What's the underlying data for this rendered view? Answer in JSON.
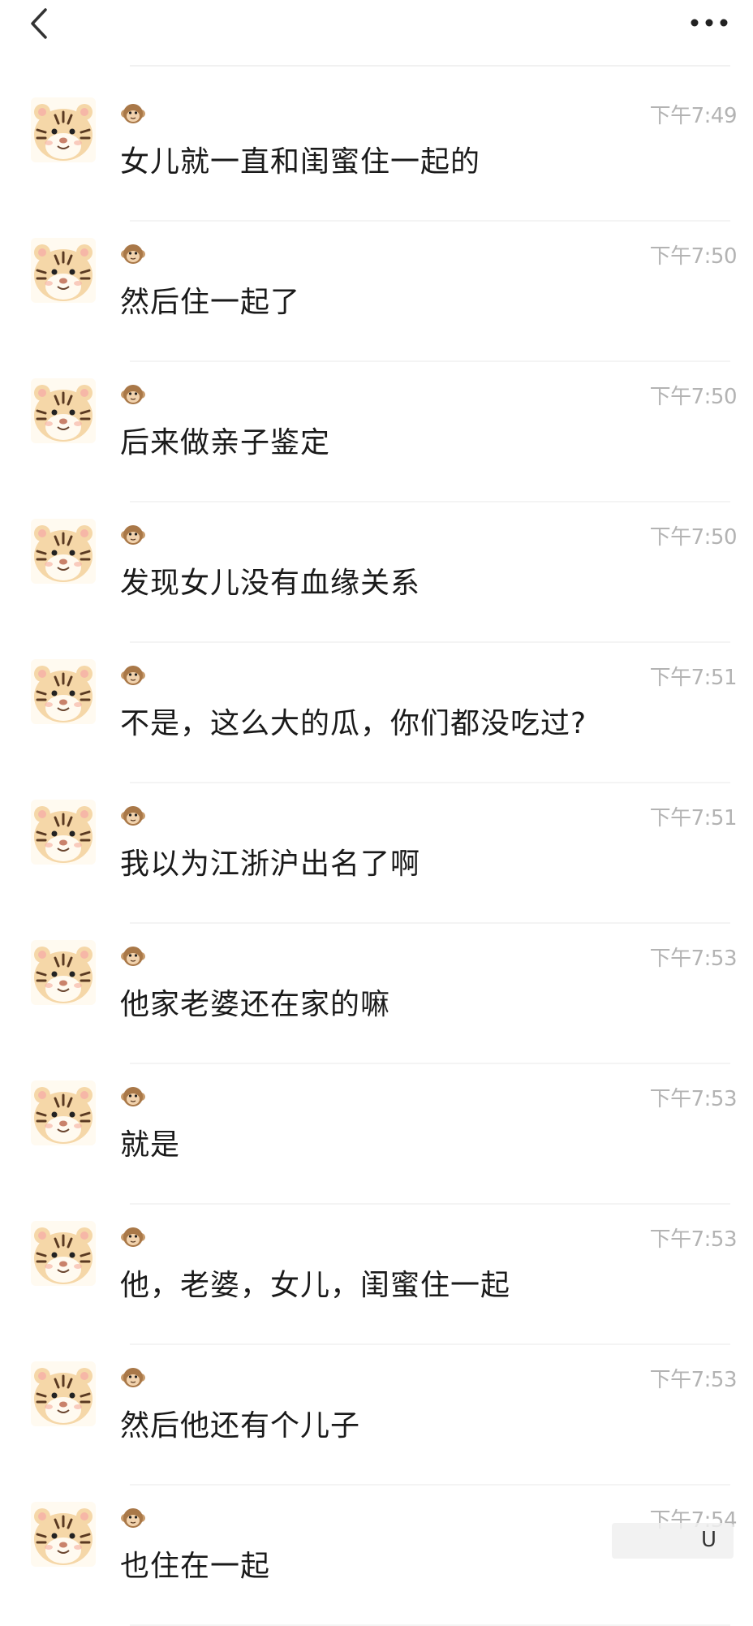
{
  "header": {
    "back_icon": "chevron-left-icon",
    "more_icon": "more-horizontal-icon"
  },
  "messages": [
    {
      "time": "下午7:49",
      "text": "女儿就一直和闺蜜住一起的"
    },
    {
      "time": "下午7:50",
      "text": "然后住一起了"
    },
    {
      "time": "下午7:50",
      "text": "后来做亲子鉴定"
    },
    {
      "time": "下午7:50",
      "text": "发现女儿没有血缘关系"
    },
    {
      "time": "下午7:51",
      "text": "不是，这么大的瓜，你们都没吃过?"
    },
    {
      "time": "下午7:51",
      "text": "我以为江浙沪出名了啊"
    },
    {
      "time": "下午7:53",
      "text": "他家老婆还在家的嘛"
    },
    {
      "time": "下午7:53",
      "text": "就是"
    },
    {
      "time": "下午7:53",
      "text": "他，老婆，女儿，闺蜜住一起"
    },
    {
      "time": "下午7:53",
      "text": "然后他还有个儿子"
    },
    {
      "time": "下午7:54",
      "text": "也住在一起"
    }
  ],
  "avatar": {
    "icon": "tiger-avatar-icon",
    "colors": {
      "fur": "#f5d7a8",
      "stripes": "#5a3a22",
      "face": "#fffaf0",
      "cheek": "#f6b7a7"
    }
  },
  "nickname_icon": "monkey-emoji-icon",
  "watermark": {
    "text": "U"
  }
}
